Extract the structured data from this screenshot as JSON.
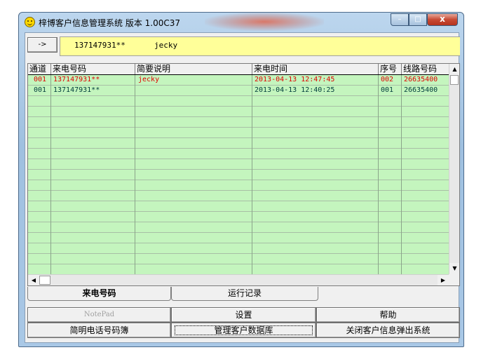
{
  "window": {
    "title": "梓博客户信息管理系统 版本 1.00C37",
    "controls": {
      "minimize": "–",
      "maximize": "□",
      "close": "x"
    }
  },
  "caller": {
    "arrow_label": "->",
    "number": "137147931**",
    "name": "jecky"
  },
  "table": {
    "columns": [
      "通道",
      "来电号码",
      "简要说明",
      "来电时间",
      "序号",
      "线路号码"
    ],
    "rows": [
      {
        "channel": "001",
        "number": "137147931**",
        "note": "jecky",
        "time": "2013-04-13 12:47:45",
        "seq": "002",
        "line": "26635400",
        "color": "#e00000"
      },
      {
        "channel": "001",
        "number": "137147931**",
        "note": "",
        "time": "2013-04-13 12:40:25",
        "seq": "001",
        "line": "26635400",
        "color": "#003c3c"
      }
    ]
  },
  "tabs": [
    {
      "label": "来电号码",
      "active": true
    },
    {
      "label": "运行记录",
      "active": false
    }
  ],
  "buttons": {
    "notepad": "NotePad",
    "settings": "设置",
    "help": "帮助",
    "phonebook": "简明电话号码簿",
    "manage_db": "管理客户数据库",
    "close_popup": "关闭客户信息弹出系统"
  },
  "colors": {
    "grid_bg": "#c4f5be",
    "caller_bg": "#ffff99"
  }
}
